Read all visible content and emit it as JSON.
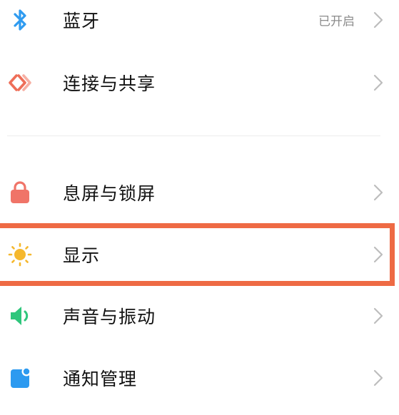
{
  "settings": {
    "items": [
      {
        "label": "蓝牙",
        "status": "已开启",
        "icon": "bluetooth-icon",
        "color": "#2f9bf0"
      },
      {
        "label": "连接与共享",
        "icon": "connection-share-icon",
        "color": "#ee6e58"
      },
      {
        "label": "息屏与锁屏",
        "icon": "lock-icon",
        "color": "#f07468"
      },
      {
        "label": "显示",
        "icon": "sun-icon",
        "color": "#f5b82e",
        "highlighted": true
      },
      {
        "label": "声音与振动",
        "icon": "speaker-icon",
        "color": "#2fc67c"
      },
      {
        "label": "通知管理",
        "icon": "notification-icon",
        "color": "#2c9af0"
      }
    ]
  },
  "colors": {
    "highlight_border": "#ee6a44",
    "chevron": "#bdbdbd",
    "divider": "#ececec"
  }
}
